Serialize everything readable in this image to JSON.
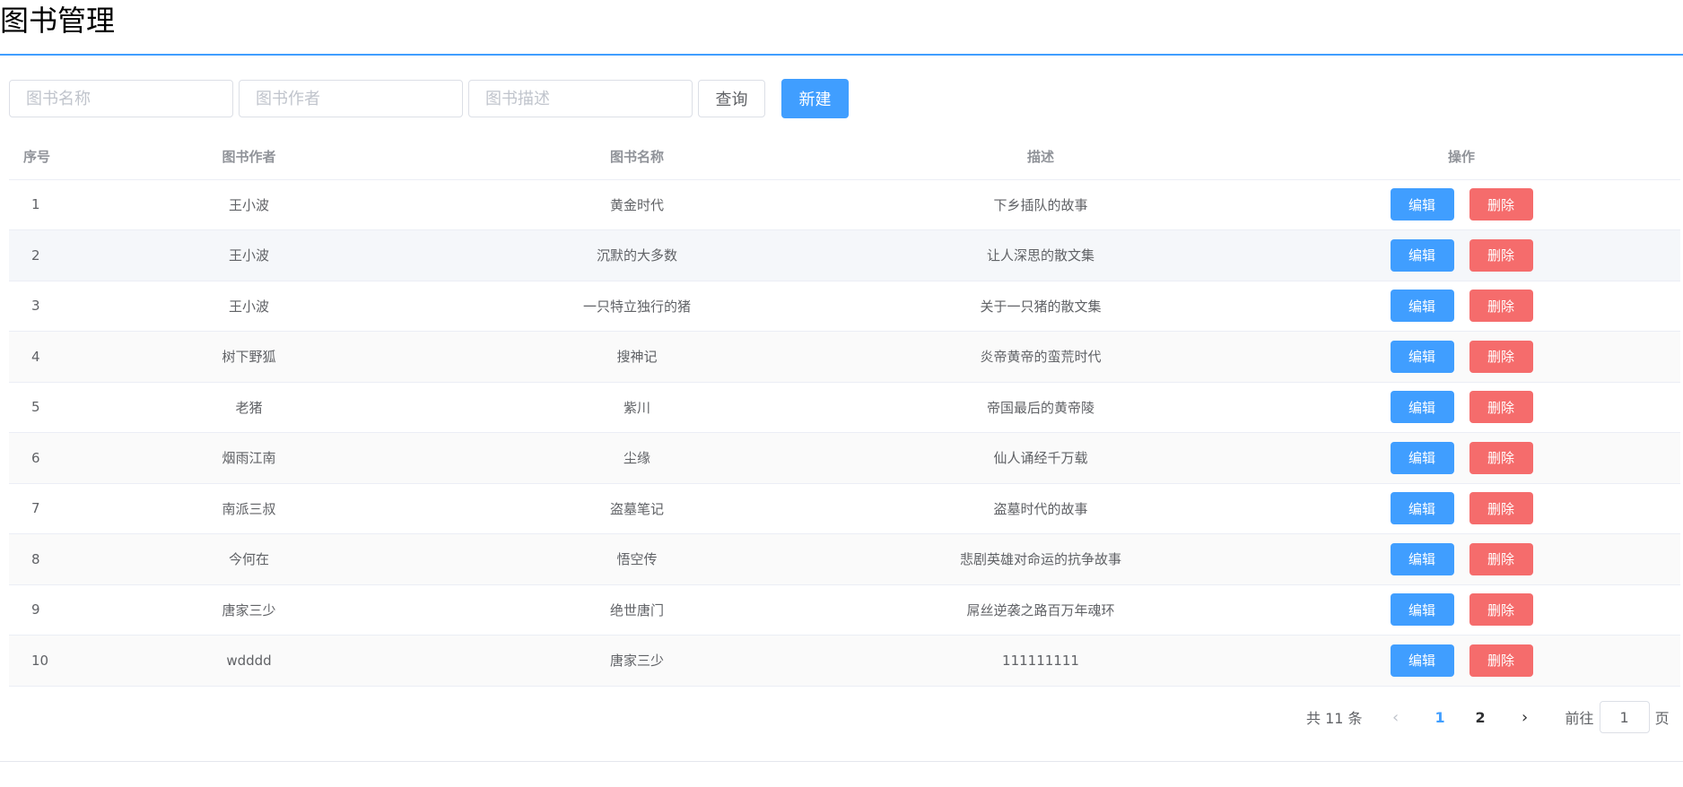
{
  "page": {
    "title": "图书管理"
  },
  "search": {
    "name_placeholder": "图书名称",
    "author_placeholder": "图书作者",
    "desc_placeholder": "图书描述",
    "query_label": "查询",
    "new_label": "新建"
  },
  "table": {
    "headers": {
      "index": "序号",
      "author": "图书作者",
      "name": "图书名称",
      "desc": "描述",
      "ops": "操作"
    },
    "edit_label": "编辑",
    "delete_label": "删除",
    "rows": [
      {
        "index": "1",
        "author": "王小波",
        "name": "黄金时代",
        "desc": "下乡插队的故事"
      },
      {
        "index": "2",
        "author": "王小波",
        "name": "沉默的大多数",
        "desc": "让人深思的散文集"
      },
      {
        "index": "3",
        "author": "王小波",
        "name": "一只特立独行的猪",
        "desc": "关于一只猪的散文集"
      },
      {
        "index": "4",
        "author": "树下野狐",
        "name": "搜神记",
        "desc": "炎帝黄帝的蛮荒时代"
      },
      {
        "index": "5",
        "author": "老猪",
        "name": "紫川",
        "desc": "帝国最后的黄帝陵"
      },
      {
        "index": "6",
        "author": "烟雨江南",
        "name": "尘缘",
        "desc": "仙人诵经千万载"
      },
      {
        "index": "7",
        "author": "南派三叔",
        "name": "盗墓笔记",
        "desc": "盗墓时代的故事"
      },
      {
        "index": "8",
        "author": "今何在",
        "name": "悟空传",
        "desc": "悲剧英雄对命运的抗争故事"
      },
      {
        "index": "9",
        "author": "唐家三少",
        "name": "绝世唐门",
        "desc": "屌丝逆袭之路百万年魂环"
      },
      {
        "index": "10",
        "author": "wdddd",
        "name": "唐家三少",
        "desc": "111111111"
      }
    ]
  },
  "pagination": {
    "total": "共 11 条",
    "pages": [
      "1",
      "2"
    ],
    "current": "1",
    "goto_prefix": "前往",
    "goto_value": "1",
    "goto_suffix": "页"
  },
  "colors": {
    "primary": "#409eff",
    "danger": "#f56c6c"
  }
}
